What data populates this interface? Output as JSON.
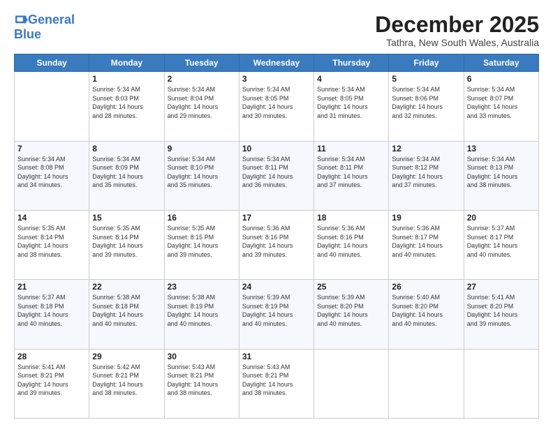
{
  "logo": {
    "general": "General",
    "blue": "Blue",
    "tagline": ""
  },
  "header": {
    "month": "December 2025",
    "location": "Tathra, New South Wales, Australia"
  },
  "weekdays": [
    "Sunday",
    "Monday",
    "Tuesday",
    "Wednesday",
    "Thursday",
    "Friday",
    "Saturday"
  ],
  "weeks": [
    [
      {
        "day": "",
        "sunrise": "",
        "sunset": "",
        "daylight": ""
      },
      {
        "day": "1",
        "sunrise": "5:34 AM",
        "sunset": "8:03 PM",
        "daylight": "14 hours and 28 minutes."
      },
      {
        "day": "2",
        "sunrise": "5:34 AM",
        "sunset": "8:04 PM",
        "daylight": "14 hours and 29 minutes."
      },
      {
        "day": "3",
        "sunrise": "5:34 AM",
        "sunset": "8:05 PM",
        "daylight": "14 hours and 30 minutes."
      },
      {
        "day": "4",
        "sunrise": "5:34 AM",
        "sunset": "8:05 PM",
        "daylight": "14 hours and 31 minutes."
      },
      {
        "day": "5",
        "sunrise": "5:34 AM",
        "sunset": "8:06 PM",
        "daylight": "14 hours and 32 minutes."
      },
      {
        "day": "6",
        "sunrise": "5:34 AM",
        "sunset": "8:07 PM",
        "daylight": "14 hours and 33 minutes."
      }
    ],
    [
      {
        "day": "7",
        "sunrise": "5:34 AM",
        "sunset": "8:08 PM",
        "daylight": "14 hours and 34 minutes."
      },
      {
        "day": "8",
        "sunrise": "5:34 AM",
        "sunset": "8:09 PM",
        "daylight": "14 hours and 35 minutes."
      },
      {
        "day": "9",
        "sunrise": "5:34 AM",
        "sunset": "8:10 PM",
        "daylight": "14 hours and 35 minutes."
      },
      {
        "day": "10",
        "sunrise": "5:34 AM",
        "sunset": "8:11 PM",
        "daylight": "14 hours and 36 minutes."
      },
      {
        "day": "11",
        "sunrise": "5:34 AM",
        "sunset": "8:11 PM",
        "daylight": "14 hours and 37 minutes."
      },
      {
        "day": "12",
        "sunrise": "5:34 AM",
        "sunset": "8:12 PM",
        "daylight": "14 hours and 37 minutes."
      },
      {
        "day": "13",
        "sunrise": "5:34 AM",
        "sunset": "8:13 PM",
        "daylight": "14 hours and 38 minutes."
      }
    ],
    [
      {
        "day": "14",
        "sunrise": "5:35 AM",
        "sunset": "8:14 PM",
        "daylight": "14 hours and 38 minutes."
      },
      {
        "day": "15",
        "sunrise": "5:35 AM",
        "sunset": "8:14 PM",
        "daylight": "14 hours and 39 minutes."
      },
      {
        "day": "16",
        "sunrise": "5:35 AM",
        "sunset": "8:15 PM",
        "daylight": "14 hours and 39 minutes."
      },
      {
        "day": "17",
        "sunrise": "5:36 AM",
        "sunset": "8:16 PM",
        "daylight": "14 hours and 39 minutes."
      },
      {
        "day": "18",
        "sunrise": "5:36 AM",
        "sunset": "8:16 PM",
        "daylight": "14 hours and 40 minutes."
      },
      {
        "day": "19",
        "sunrise": "5:36 AM",
        "sunset": "8:17 PM",
        "daylight": "14 hours and 40 minutes."
      },
      {
        "day": "20",
        "sunrise": "5:37 AM",
        "sunset": "8:17 PM",
        "daylight": "14 hours and 40 minutes."
      }
    ],
    [
      {
        "day": "21",
        "sunrise": "5:37 AM",
        "sunset": "8:18 PM",
        "daylight": "14 hours and 40 minutes."
      },
      {
        "day": "22",
        "sunrise": "5:38 AM",
        "sunset": "8:18 PM",
        "daylight": "14 hours and 40 minutes."
      },
      {
        "day": "23",
        "sunrise": "5:38 AM",
        "sunset": "8:19 PM",
        "daylight": "14 hours and 40 minutes."
      },
      {
        "day": "24",
        "sunrise": "5:39 AM",
        "sunset": "8:19 PM",
        "daylight": "14 hours and 40 minutes."
      },
      {
        "day": "25",
        "sunrise": "5:39 AM",
        "sunset": "8:20 PM",
        "daylight": "14 hours and 40 minutes."
      },
      {
        "day": "26",
        "sunrise": "5:40 AM",
        "sunset": "8:20 PM",
        "daylight": "14 hours and 40 minutes."
      },
      {
        "day": "27",
        "sunrise": "5:41 AM",
        "sunset": "8:20 PM",
        "daylight": "14 hours and 39 minutes."
      }
    ],
    [
      {
        "day": "28",
        "sunrise": "5:41 AM",
        "sunset": "8:21 PM",
        "daylight": "14 hours and 39 minutes."
      },
      {
        "day": "29",
        "sunrise": "5:42 AM",
        "sunset": "8:21 PM",
        "daylight": "14 hours and 38 minutes."
      },
      {
        "day": "30",
        "sunrise": "5:43 AM",
        "sunset": "8:21 PM",
        "daylight": "14 hours and 38 minutes."
      },
      {
        "day": "31",
        "sunrise": "5:43 AM",
        "sunset": "8:21 PM",
        "daylight": "14 hours and 38 minutes."
      },
      {
        "day": "",
        "sunrise": "",
        "sunset": "",
        "daylight": ""
      },
      {
        "day": "",
        "sunrise": "",
        "sunset": "",
        "daylight": ""
      },
      {
        "day": "",
        "sunrise": "",
        "sunset": "",
        "daylight": ""
      }
    ]
  ]
}
